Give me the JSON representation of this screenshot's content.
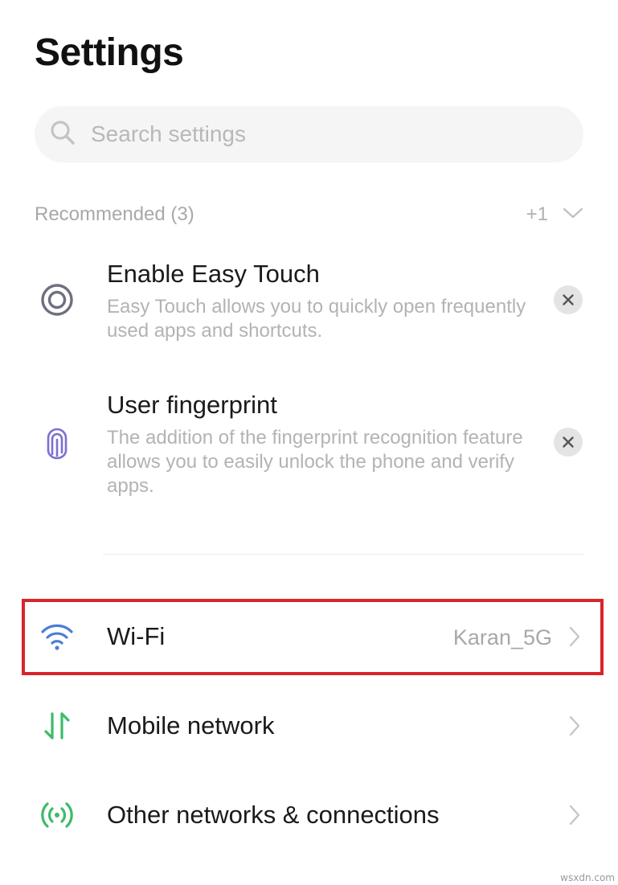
{
  "header": {
    "title": "Settings"
  },
  "search": {
    "placeholder": "Search settings",
    "icon": "search-icon"
  },
  "recommended": {
    "label": "Recommended (3)",
    "more_count": "+1",
    "items": [
      {
        "title": "Enable Easy Touch",
        "description": "Easy Touch allows you to quickly open frequently used apps and shortcuts.",
        "icon": "easy-touch-icon"
      },
      {
        "title": "User fingerprint",
        "description": "The addition of the fingerprint recognition feature allows you to easily unlock the phone and verify apps.",
        "icon": "fingerprint-icon"
      }
    ]
  },
  "settings": [
    {
      "label": "Wi-Fi",
      "value": "Karan_5G",
      "icon": "wifi-icon",
      "highlighted": true
    },
    {
      "label": "Mobile network",
      "value": "",
      "icon": "mobile-network-icon"
    },
    {
      "label": "Other networks & connections",
      "value": "",
      "icon": "other-connections-icon"
    }
  ],
  "colors": {
    "highlight": "#d9252a",
    "wifi": "#4a7fd4",
    "network_green": "#3dbb6a",
    "recommend_icon": "#6e6f80",
    "fingerprint": "#7b6fd1"
  },
  "watermark": "wsxdn.com"
}
